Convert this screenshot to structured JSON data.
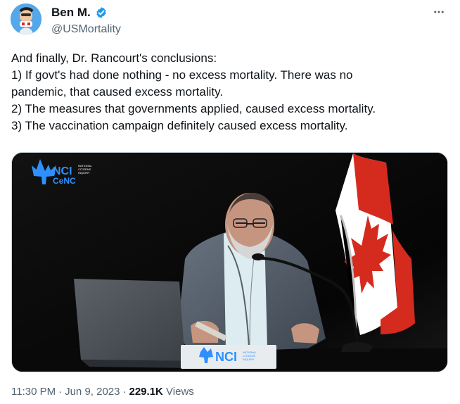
{
  "author": {
    "display_name": "Ben M.",
    "handle": "@USMortality",
    "verified": true,
    "avatar_icon": "profile-avatar"
  },
  "menu": {
    "more_icon": "more-horizontal-icon"
  },
  "tweet": {
    "text": "And finally, Dr. Rancourt's conclusions:\n1) If govt's had done nothing - no excess mortality. There was no\npandemic, that caused excess mortality.\n2) The measures that governments applied, caused excess mortality.\n3) The vaccination campaign definitely caused excess mortality."
  },
  "media": {
    "logo_nci": "NCI",
    "logo_cenc": "CeNC",
    "logo_small_text": [
      "NATIONAL",
      "CITIZENS",
      "INQUIRY"
    ],
    "nameplate_nci": "NCI",
    "nameplate_small_text": [
      "NATIONAL",
      "CITIZENS",
      "INQUIRY"
    ]
  },
  "footer": {
    "time": "11:30 PM",
    "date": "Jun 9, 2023",
    "views_count": "229.1K",
    "views_label": "Views"
  },
  "colors": {
    "verified_blue": "#1d9bf0",
    "secondary_text": "#536471",
    "flag_red": "#d52b1e"
  }
}
